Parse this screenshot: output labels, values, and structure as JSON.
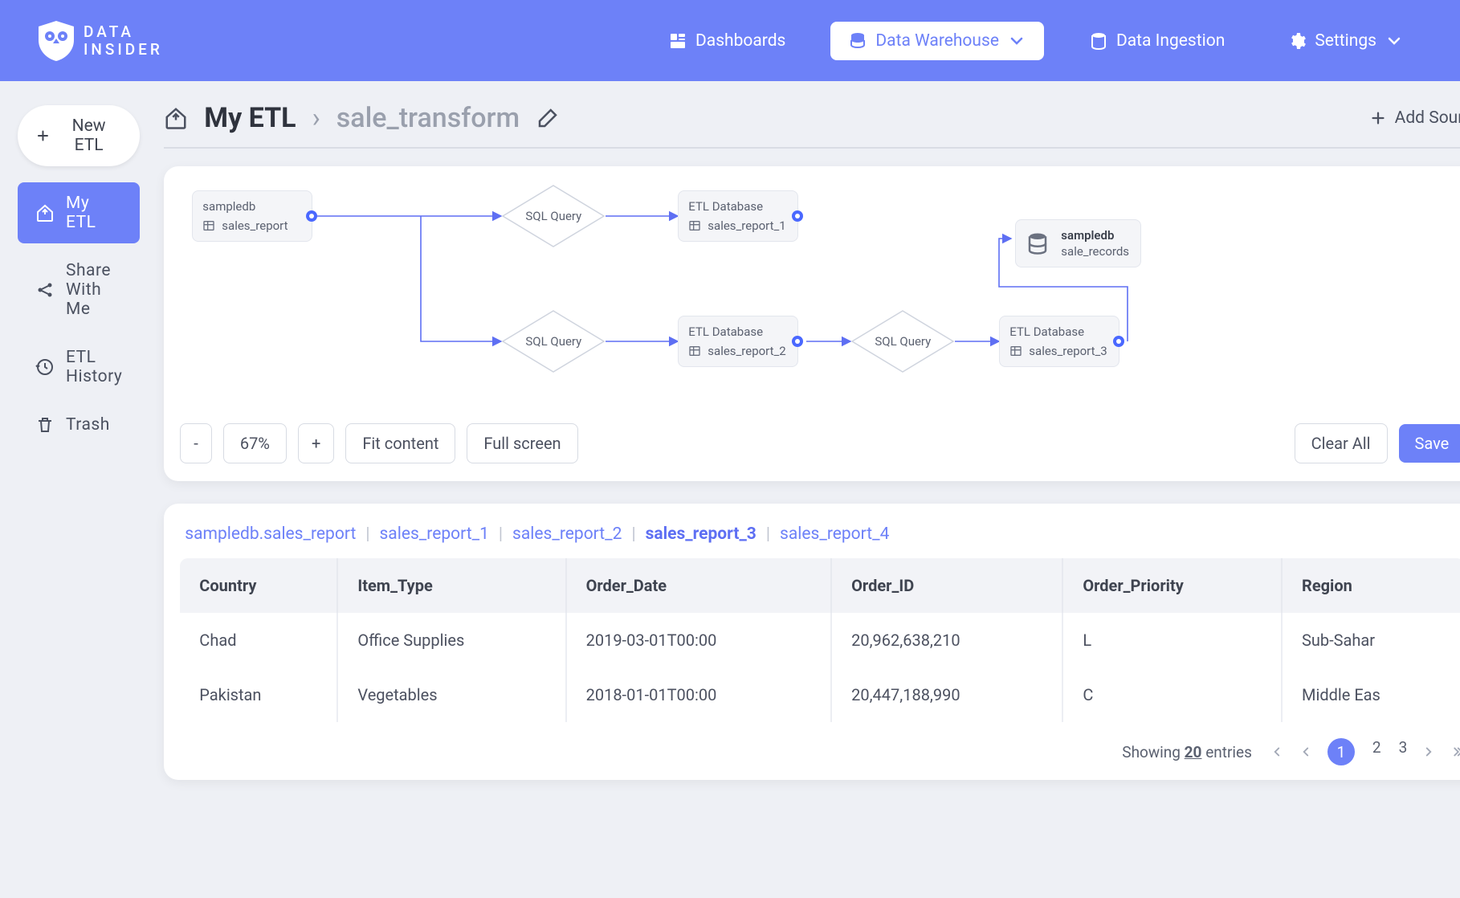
{
  "brand": {
    "line1": "DATA",
    "line2": "INSIDER"
  },
  "nav": {
    "dashboards": "Dashboards",
    "warehouse": "Data Warehouse",
    "ingestion": "Data Ingestion",
    "settings": "Settings"
  },
  "sidebar": {
    "newEtl": "New ETL",
    "myEtl": "My ETL",
    "share": "Share With Me",
    "history": "ETL History",
    "trash": "Trash"
  },
  "breadcrumb": {
    "root": "My ETL",
    "node": "sale_transform",
    "addSource": "Add Source"
  },
  "canvas": {
    "zoomOut": "-",
    "zoomLevel": "67%",
    "zoomIn": "+",
    "fit": "Fit content",
    "full": "Full screen",
    "clear": "Clear All",
    "save": "Save",
    "nodes": {
      "source": {
        "hdr": "sampledb",
        "body": "sales_report"
      },
      "query1": {
        "lbl": "SQL Query"
      },
      "db1": {
        "hdr": "ETL Database",
        "body": "sales_report_1"
      },
      "dest": {
        "hdr": "sampledb",
        "sub": "sale_records"
      },
      "query2": {
        "lbl": "SQL Query"
      },
      "db2": {
        "hdr": "ETL Database",
        "body": "sales_report_2"
      },
      "query3": {
        "lbl": "SQL Query"
      },
      "db3": {
        "hdr": "ETL Database",
        "body": "sales_report_3"
      }
    }
  },
  "results": {
    "tabs": [
      "sampledb.sales_report",
      "sales_report_1",
      "sales_report_2",
      "sales_report_3",
      "sales_report_4"
    ],
    "activeIndex": 3,
    "columns": [
      "Country",
      "Item_Type",
      "Order_Date",
      "Order_ID",
      "Order_Priority",
      "Region"
    ],
    "rows": [
      [
        "Chad",
        "Office Supplies",
        "2019-03-01T00:00",
        "20,962,638,210",
        "L",
        "Sub-Sahar"
      ],
      [
        "Pakistan",
        "Vegetables",
        "2018-01-01T00:00",
        "20,447,188,990",
        "C",
        "Middle Eas"
      ]
    ],
    "showingPrefix": "Showing",
    "showingCount": "20",
    "showingSuffix": "entries",
    "pages": [
      "1",
      "2",
      "3"
    ]
  }
}
